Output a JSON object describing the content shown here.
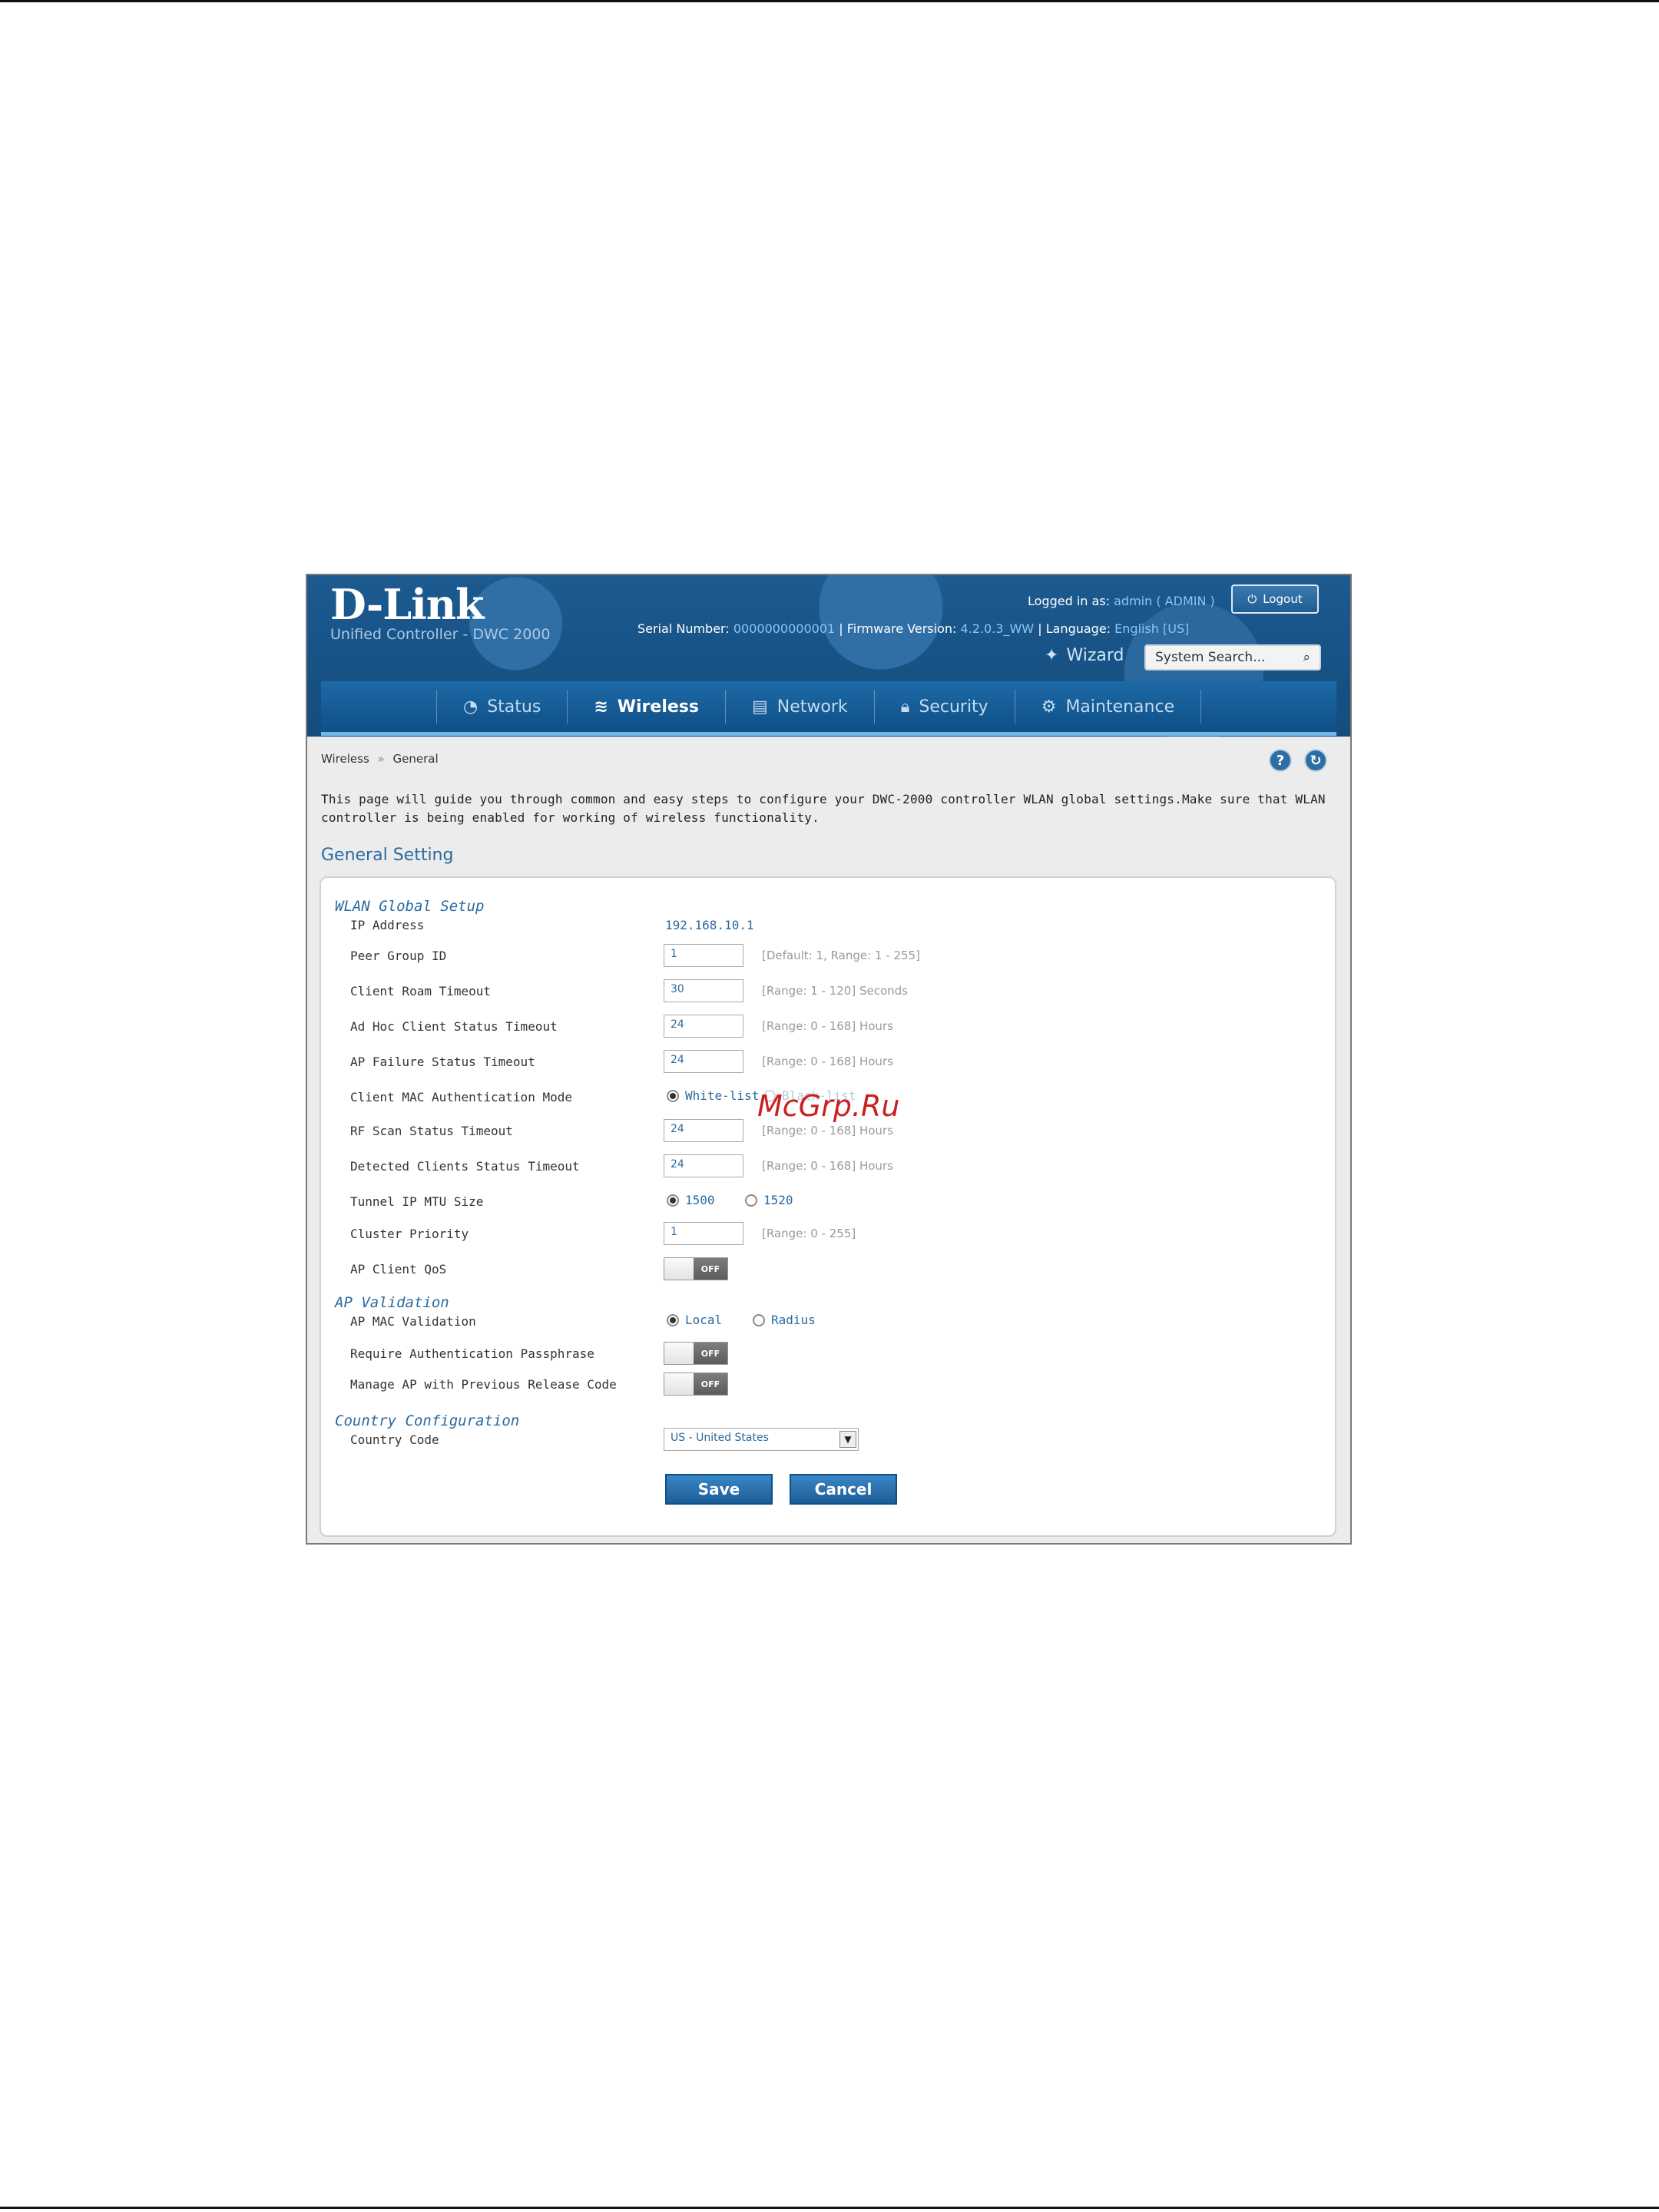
{
  "header": {
    "logo": "D-Link",
    "product": "Unified Controller - DWC 2000",
    "logged_in_label": "Logged in as:",
    "logged_in_user": "admin ( ADMIN )",
    "logout_label": "Logout",
    "serial_label": "Serial Number:",
    "serial_value": "0000000000001",
    "firmware_label": "Firmware Version:",
    "firmware_value": "4.2.0.3_WW",
    "language_label": "Language:",
    "language_value": "English [US]",
    "wizard_label": "Wizard",
    "search_placeholder": "System Search..."
  },
  "nav": {
    "status": "Status",
    "wireless": "Wireless",
    "network": "Network",
    "security": "Security",
    "maintenance": "Maintenance"
  },
  "breadcrumb": {
    "root": "Wireless",
    "sep": "»",
    "current": "General"
  },
  "description": "This page will guide you through common and easy steps to configure your DWC-2000 controller WLAN global settings.Make sure that WLAN controller is being enabled for working of wireless functionality.",
  "section_title": "General Setting",
  "wlan": {
    "title": "WLAN Global Setup",
    "ip_label": "IP Address",
    "ip_value": "192.168.10.1",
    "peer_label": "Peer Group ID",
    "peer_value": "1",
    "peer_hint": "[Default: 1, Range: 1 - 255]",
    "roam_label": "Client Roam Timeout",
    "roam_value": "30",
    "roam_hint": "[Range: 1 - 120] Seconds",
    "adhoc_label": "Ad Hoc Client Status Timeout",
    "adhoc_value": "24",
    "adhoc_hint": "[Range: 0 - 168] Hours",
    "apfail_label": "AP Failure Status Timeout",
    "apfail_value": "24",
    "apfail_hint": "[Range: 0 - 168] Hours",
    "mac_mode_label": "Client MAC Authentication Mode",
    "mac_mode_white": "White-list",
    "mac_mode_black": "Black-list",
    "rfscan_label": "RF Scan Status Timeout",
    "rfscan_value": "24",
    "rfscan_hint": "[Range: 0 - 168] Hours",
    "detected_label": "Detected Clients Status Timeout",
    "detected_value": "24",
    "detected_hint": "[Range: 0 - 168] Hours",
    "mtu_label": "Tunnel IP MTU Size",
    "mtu_1500": "1500",
    "mtu_1520": "1520",
    "cluster_label": "Cluster Priority",
    "cluster_value": "1",
    "cluster_hint": "[Range: 0 - 255]",
    "qos_label": "AP Client QoS",
    "toggle_off": "OFF"
  },
  "validation": {
    "title": "AP Validation",
    "mac_label": "AP MAC Validation",
    "local": "Local",
    "radius": "Radius",
    "passphrase_label": "Require Authentication Passphrase",
    "previous_label": "Manage AP with Previous Release Code"
  },
  "country": {
    "title": "Country Configuration",
    "code_label": "Country Code",
    "code_value": "US - United States"
  },
  "buttons": {
    "save": "Save",
    "cancel": "Cancel"
  },
  "watermark": "McGrp.Ru",
  "colors": {
    "header": "#1c5a90",
    "accent": "#2a6aa0",
    "watermark": "#cc1f1f"
  }
}
